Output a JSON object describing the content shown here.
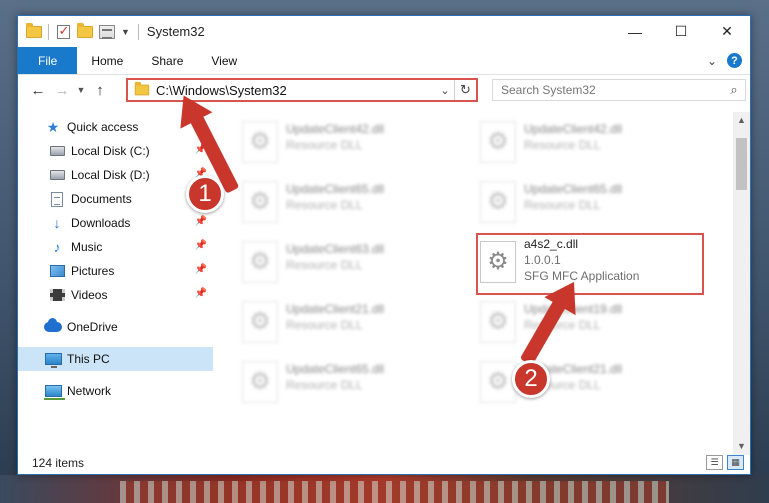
{
  "window": {
    "title": "System32",
    "controls": {
      "minimize": "—",
      "maximize": "☐",
      "close": "✕"
    }
  },
  "ribbon": {
    "tabs": [
      "File",
      "Home",
      "Share",
      "View"
    ]
  },
  "address": {
    "path": "C:\\Windows\\System32"
  },
  "search": {
    "placeholder": "Search System32"
  },
  "sidebar": {
    "items": [
      {
        "label": "Quick access",
        "icon": "star-icon"
      },
      {
        "label": "Local Disk (C:)",
        "icon": "disk-icon"
      },
      {
        "label": "Local Disk (D:)",
        "icon": "disk-icon"
      },
      {
        "label": "Documents",
        "icon": "documents-icon"
      },
      {
        "label": "Downloads",
        "icon": "downloads-icon"
      },
      {
        "label": "Music",
        "icon": "music-icon"
      },
      {
        "label": "Pictures",
        "icon": "pictures-icon"
      },
      {
        "label": "Videos",
        "icon": "videos-icon"
      },
      {
        "label": "OneDrive",
        "icon": "onedrive-icon"
      },
      {
        "label": "This PC",
        "icon": "this-pc-icon"
      },
      {
        "label": "Network",
        "icon": "network-icon"
      }
    ],
    "selected": "This PC"
  },
  "files": [
    {
      "name": "UpdateClient42.dll",
      "type": "Resource DLL"
    },
    {
      "name": "UpdateClient42.dll",
      "type": "Resource DLL"
    },
    {
      "name": "UpdateClient65.dll",
      "type": "Resource DLL"
    },
    {
      "name": "UpdateClient65.dll",
      "type": "Resource DLL"
    },
    {
      "name": "UpdateClient63.dll",
      "type": "Resource DLL"
    },
    {
      "name": "a4s2_c.dll",
      "version": "1.0.0.1",
      "type": "SFG MFC Application"
    },
    {
      "name": "UpdateClient21.dll",
      "type": "Resource DLL"
    },
    {
      "name": "UpdateClient19.dll",
      "type": "Resource DLL"
    },
    {
      "name": "UpdateClient65.dll",
      "type": "Resource DLL"
    },
    {
      "name": "UpdateClient21.dll",
      "type": "Resource DLL"
    }
  ],
  "status": {
    "item_count": "124 items"
  },
  "annotations": {
    "step1": "1",
    "step2": "2"
  },
  "colors": {
    "accent": "#1979ca",
    "highlight": "#d9534f",
    "annotation": "#c9362b",
    "selection": "#cce4f7"
  }
}
